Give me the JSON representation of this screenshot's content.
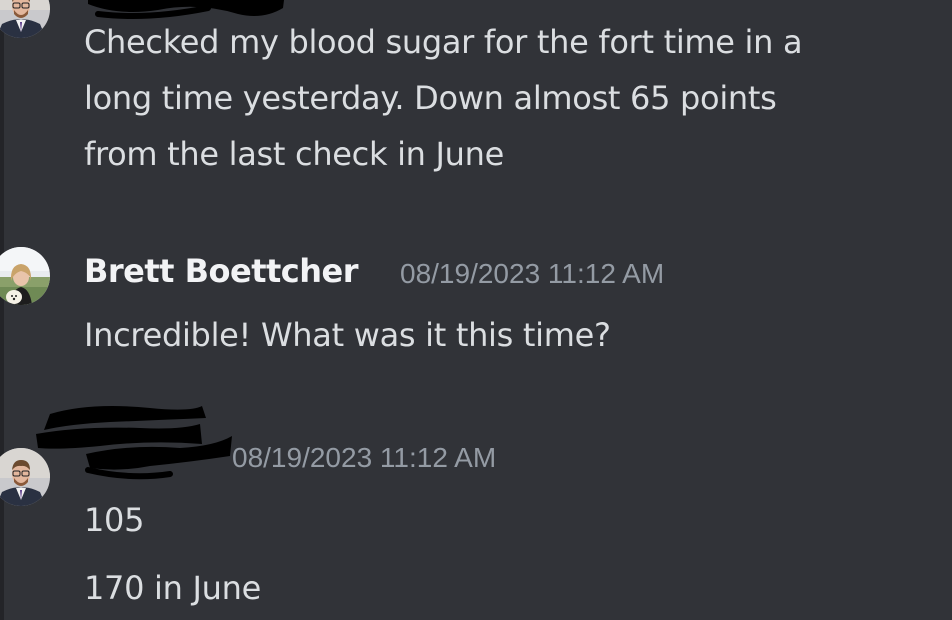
{
  "messages": [
    {
      "author": "",
      "timestamp": "",
      "lines": [
        "Checked my blood sugar for the fort time in a",
        "long time yesterday. Down almost 65 points",
        "from the last check in June"
      ]
    },
    {
      "author": "Brett Boettcher",
      "timestamp": "08/19/2023 11:12 AM",
      "lines": [
        "Incredible! What was it this time?"
      ]
    },
    {
      "author": "",
      "timestamp": "08/19/2023 11:12 AM",
      "lines": [
        "105",
        "170 in June"
      ]
    }
  ],
  "colors": {
    "background": "#313338",
    "text": "#dbdee1",
    "username": "#f2f3f5",
    "timestamp": "#949ba4",
    "redaction": "#000000"
  },
  "icons": [
    "user-avatar-man-suit-icon",
    "user-avatar-woman-dog-icon"
  ]
}
